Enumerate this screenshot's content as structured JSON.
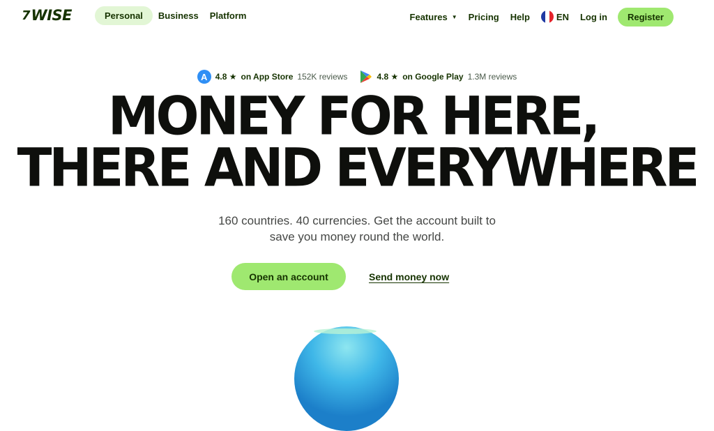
{
  "brand": {
    "mark": "7",
    "name": "WISE"
  },
  "nav_left": [
    {
      "label": "Personal",
      "active": true
    },
    {
      "label": "Business"
    },
    {
      "label": "Platform"
    }
  ],
  "nav_right": {
    "features": "Features",
    "pricing": "Pricing",
    "help": "Help",
    "language": "EN",
    "login": "Log in",
    "register": "Register"
  },
  "ratings": [
    {
      "store_icon": "app-store-icon",
      "value": "4.8 ★",
      "store": "on App Store",
      "reviews": "152K reviews"
    },
    {
      "store_icon": "google-play-icon",
      "value": "4.8 ★",
      "store": "on Google Play",
      "reviews": "1.3M reviews"
    }
  ],
  "hero": {
    "line1": "MONEY FOR HERE,",
    "line2": "THERE AND EVERYWHERE",
    "subtitle_line1": "160 countries. 40 currencies. Get the account built to",
    "subtitle_line2": "save you money round the world.",
    "primary_cta": "Open an account",
    "secondary_cta": "Send money now"
  },
  "colors": {
    "brand_green": "#9fe870",
    "forest": "#163300",
    "pill_bg": "#e2f6d5"
  }
}
